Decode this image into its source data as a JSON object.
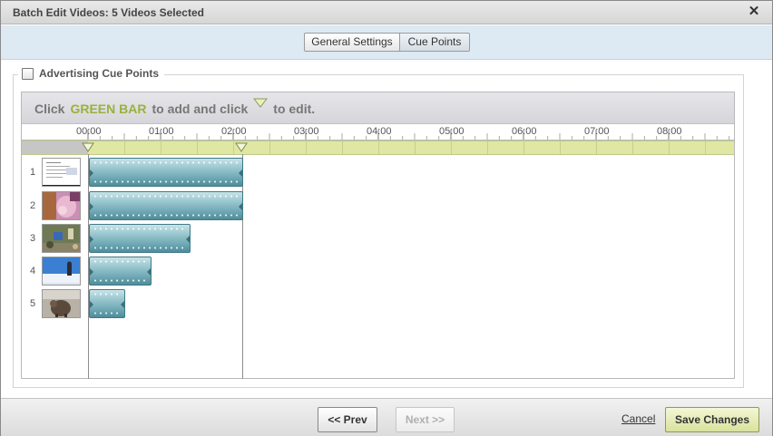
{
  "dialog": {
    "title": "Batch Edit Videos: 5 Videos Selected",
    "close_glyph": "✕"
  },
  "tabs": [
    {
      "label": "General Settings",
      "selected": false
    },
    {
      "label": "Cue Points",
      "selected": true
    }
  ],
  "section": {
    "label": "Advertising Cue Points",
    "checked": false
  },
  "hint": {
    "part1": "Click",
    "highlight": "GREEN BAR",
    "part2": "to add and click",
    "part3": "to edit."
  },
  "timeline": {
    "ruler_labels": [
      "00:00",
      "01:00",
      "02:00",
      "03:00",
      "04:00",
      "05:00",
      "06:00",
      "07:00",
      "08:00"
    ],
    "cue_markers": [
      "00:00",
      "02:07"
    ],
    "rows": [
      {
        "number": "1",
        "duration": "02:07"
      },
      {
        "number": "2",
        "duration": "02:07"
      },
      {
        "number": "3",
        "duration": "01:23"
      },
      {
        "number": "4",
        "duration": "00:51"
      },
      {
        "number": "5",
        "duration": "00:29"
      }
    ],
    "colors": {
      "green_bar": "#dfe7a3",
      "clip": "#6fa9b5"
    }
  },
  "footer": {
    "prev_label": "<< Prev",
    "next_label": "Next >>",
    "next_disabled": true,
    "cancel_label": "Cancel",
    "save_label": "Save Changes"
  }
}
